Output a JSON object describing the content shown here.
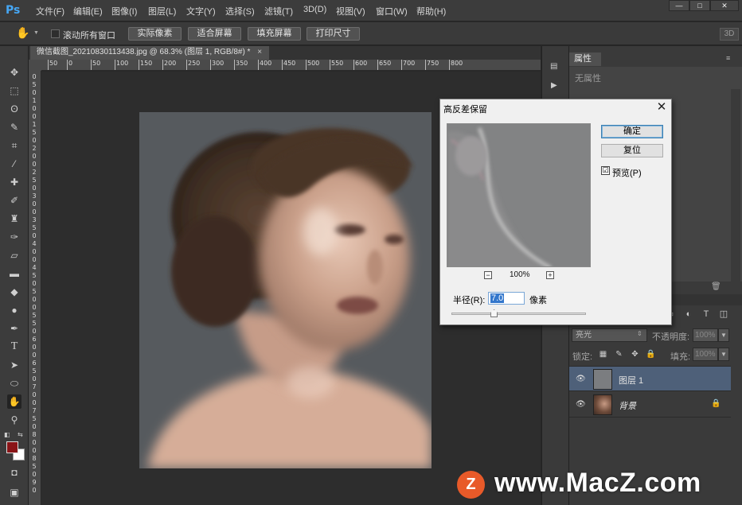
{
  "app": {
    "logo": "Ps"
  },
  "menu": [
    "文件(F)",
    "编辑(E)",
    "图像(I)",
    "图层(L)",
    "文字(Y)",
    "选择(S)",
    "滤镜(T)",
    "3D(D)",
    "视图(V)",
    "窗口(W)",
    "帮助(H)"
  ],
  "window_controls": {
    "minimize": "—",
    "maximize": "□",
    "close": "✕"
  },
  "options": {
    "scroll_all_windows": "滚动所有窗口",
    "actual_pixels": "实际像素",
    "fit_screen": "适合屏幕",
    "fill_screen": "填充屏幕",
    "print_size": "打印尺寸",
    "btn_3d": "3D"
  },
  "document": {
    "tab_title": "微信截图_20210830113438.jpg @ 68.3% (图层 1, RGB/8#) *",
    "ruler_top_ticks": [
      "50",
      "0",
      "50",
      "100",
      "150",
      "200",
      "250",
      "300",
      "350",
      "400",
      "450",
      "500",
      "550",
      "600",
      "650",
      "700",
      "750",
      "800"
    ],
    "ruler_left_ticks": [
      "0",
      "5",
      "0",
      "1",
      "0",
      "0",
      "1",
      "5",
      "0",
      "2",
      "0",
      "0",
      "2",
      "5",
      "0",
      "3",
      "0",
      "0",
      "3",
      "5",
      "0",
      "4",
      "0",
      "0",
      "4",
      "5",
      "0",
      "5",
      "0",
      "0",
      "5",
      "5",
      "0",
      "6",
      "0",
      "0",
      "6",
      "5",
      "0",
      "7",
      "0",
      "0",
      "7",
      "5",
      "0",
      "8",
      "0",
      "0",
      "8",
      "5",
      "0",
      "9",
      "0"
    ]
  },
  "properties": {
    "tab": "属性",
    "no_properties": "无属性"
  },
  "layers": {
    "blend_mode": "亮光",
    "opacity_label": "不透明度:",
    "opacity_value": "100%",
    "lock_label": "锁定:",
    "fill_label": "填充:",
    "fill_value": "100%",
    "items": [
      {
        "name": "图层 1",
        "selected": true
      },
      {
        "name": "背景",
        "locked": true
      }
    ]
  },
  "dialog": {
    "title": "高反差保留",
    "ok": "确定",
    "reset": "复位",
    "preview_label": "预览(P)",
    "preview_checked": "☑",
    "zoom": "100%",
    "zoom_minus": "−",
    "zoom_plus": "+",
    "radius_label": "半径(R):",
    "radius_value": "7.0",
    "radius_unit": "像素",
    "radius_slider_fraction": 0.32
  },
  "watermark": {
    "logo_letter": "Z",
    "text": "www.MacZ.com"
  }
}
